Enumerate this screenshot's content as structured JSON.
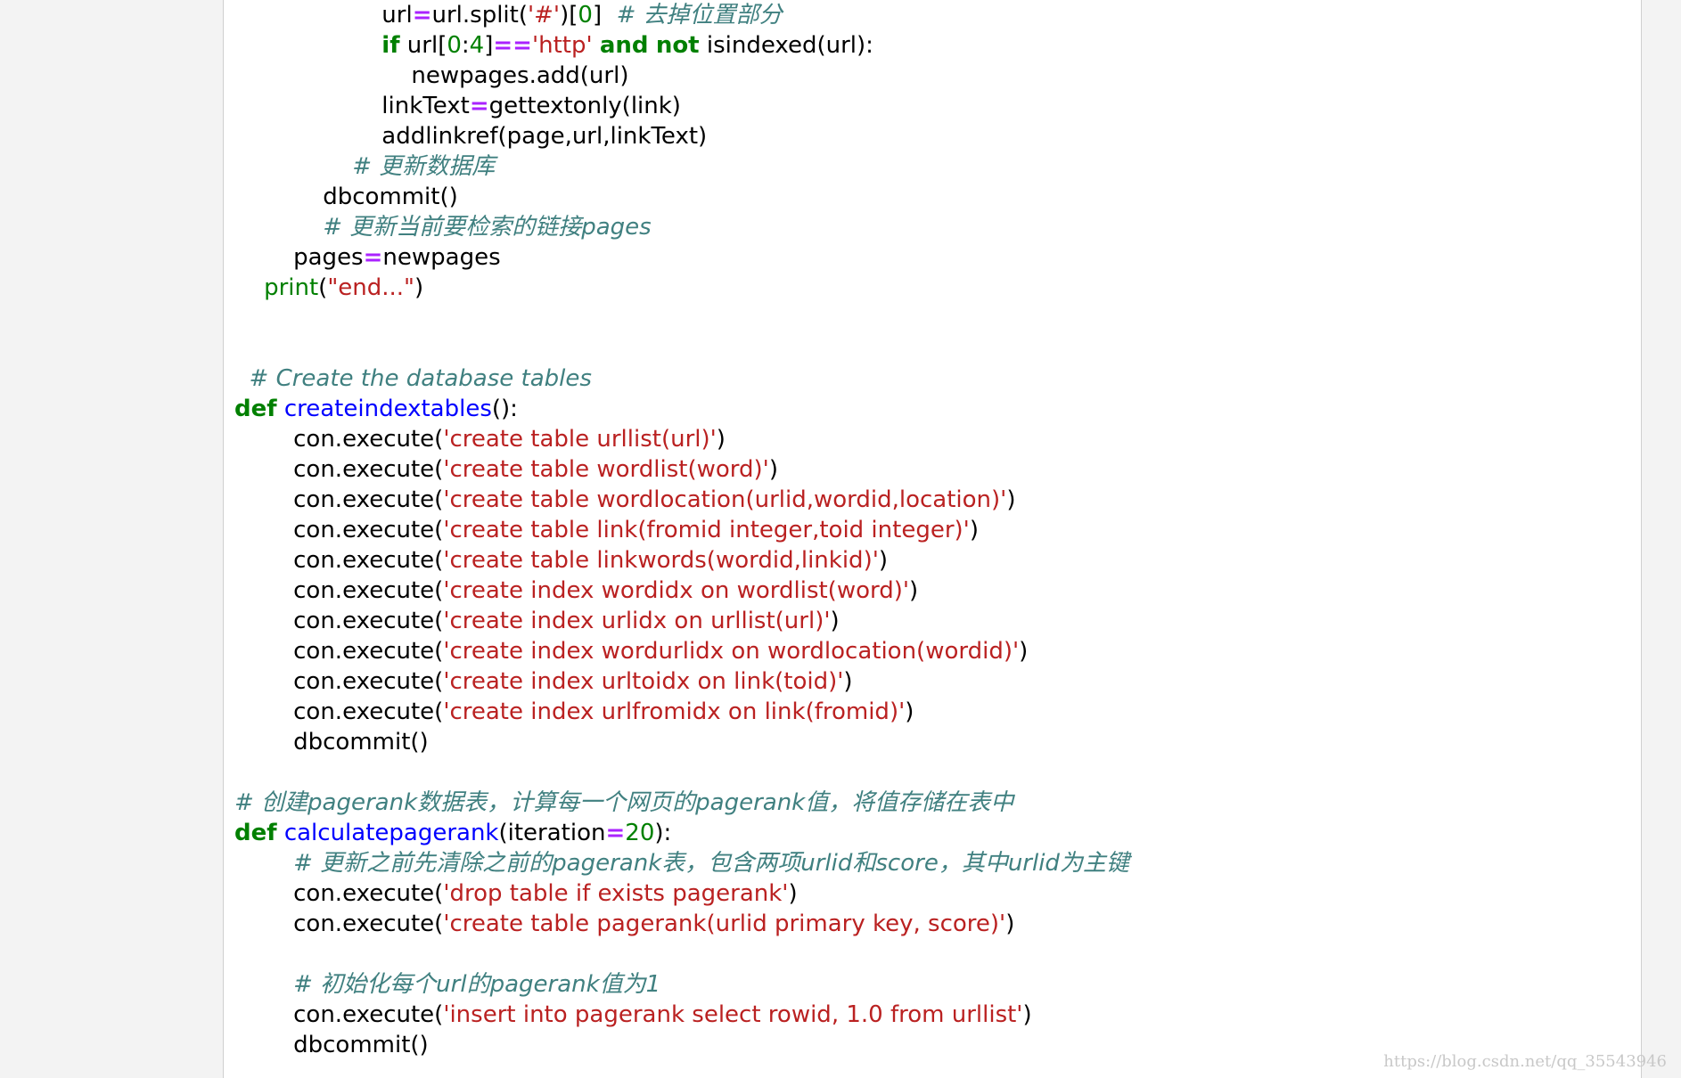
{
  "code": {
    "lines": [
      [
        {
          "t": "                    "
        },
        {
          "t": "url"
        },
        {
          "t": "=",
          "c": "op"
        },
        {
          "t": "url.split("
        },
        {
          "t": "'#'",
          "c": "st"
        },
        {
          "t": ")["
        },
        {
          "t": "0",
          "c": "nu"
        },
        {
          "t": "]  "
        },
        {
          "t": "# 去掉位置部分",
          "c": "cm"
        }
      ],
      [
        {
          "t": "                    "
        },
        {
          "t": "if",
          "c": "kw"
        },
        {
          "t": " url["
        },
        {
          "t": "0",
          "c": "nu"
        },
        {
          "t": ":"
        },
        {
          "t": "4",
          "c": "nu"
        },
        {
          "t": "]"
        },
        {
          "t": "==",
          "c": "op"
        },
        {
          "t": "'http'",
          "c": "st"
        },
        {
          "t": " "
        },
        {
          "t": "and",
          "c": "kw"
        },
        {
          "t": " "
        },
        {
          "t": "not",
          "c": "kw"
        },
        {
          "t": " isindexed(url):"
        }
      ],
      [
        {
          "t": "                        "
        },
        {
          "t": "newpages.add(url)"
        }
      ],
      [
        {
          "t": "                    "
        },
        {
          "t": "linkText"
        },
        {
          "t": "=",
          "c": "op"
        },
        {
          "t": "gettextonly(link)"
        }
      ],
      [
        {
          "t": "                    "
        },
        {
          "t": "addlinkref(page,url,linkText)"
        }
      ],
      [
        {
          "t": "                "
        },
        {
          "t": "# 更新数据库",
          "c": "cm"
        }
      ],
      [
        {
          "t": "            "
        },
        {
          "t": "dbcommit()"
        }
      ],
      [
        {
          "t": "            "
        },
        {
          "t": "# 更新当前要检索的链接pages",
          "c": "cm"
        }
      ],
      [
        {
          "t": "        "
        },
        {
          "t": "pages"
        },
        {
          "t": "=",
          "c": "op"
        },
        {
          "t": "newpages"
        }
      ],
      [
        {
          "t": "    "
        },
        {
          "t": "print",
          "c": "bi"
        },
        {
          "t": "("
        },
        {
          "t": "\"end...\"",
          "c": "st"
        },
        {
          "t": ")"
        }
      ],
      [],
      [],
      [
        {
          "t": "  "
        },
        {
          "t": "# Create the database tables",
          "c": "cm"
        }
      ],
      [
        {
          "t": "def",
          "c": "kw"
        },
        {
          "t": " "
        },
        {
          "t": "createindextables",
          "c": "fn"
        },
        {
          "t": "():"
        }
      ],
      [
        {
          "t": "        "
        },
        {
          "t": "con.execute("
        },
        {
          "t": "'create table urllist(url)'",
          "c": "st"
        },
        {
          "t": ")"
        }
      ],
      [
        {
          "t": "        "
        },
        {
          "t": "con.execute("
        },
        {
          "t": "'create table wordlist(word)'",
          "c": "st"
        },
        {
          "t": ")"
        }
      ],
      [
        {
          "t": "        "
        },
        {
          "t": "con.execute("
        },
        {
          "t": "'create table wordlocation(urlid,wordid,location)'",
          "c": "st"
        },
        {
          "t": ")"
        }
      ],
      [
        {
          "t": "        "
        },
        {
          "t": "con.execute("
        },
        {
          "t": "'create table link(fromid integer,toid integer)'",
          "c": "st"
        },
        {
          "t": ")"
        }
      ],
      [
        {
          "t": "        "
        },
        {
          "t": "con.execute("
        },
        {
          "t": "'create table linkwords(wordid,linkid)'",
          "c": "st"
        },
        {
          "t": ")"
        }
      ],
      [
        {
          "t": "        "
        },
        {
          "t": "con.execute("
        },
        {
          "t": "'create index wordidx on wordlist(word)'",
          "c": "st"
        },
        {
          "t": ")"
        }
      ],
      [
        {
          "t": "        "
        },
        {
          "t": "con.execute("
        },
        {
          "t": "'create index urlidx on urllist(url)'",
          "c": "st"
        },
        {
          "t": ")"
        }
      ],
      [
        {
          "t": "        "
        },
        {
          "t": "con.execute("
        },
        {
          "t": "'create index wordurlidx on wordlocation(wordid)'",
          "c": "st"
        },
        {
          "t": ")"
        }
      ],
      [
        {
          "t": "        "
        },
        {
          "t": "con.execute("
        },
        {
          "t": "'create index urltoidx on link(toid)'",
          "c": "st"
        },
        {
          "t": ")"
        }
      ],
      [
        {
          "t": "        "
        },
        {
          "t": "con.execute("
        },
        {
          "t": "'create index urlfromidx on link(fromid)'",
          "c": "st"
        },
        {
          "t": ")"
        }
      ],
      [
        {
          "t": "        "
        },
        {
          "t": "dbcommit()"
        }
      ],
      [],
      [
        {
          "t": "# 创建pagerank数据表，计算每一个网页的pagerank值，将值存储在表中",
          "c": "cm"
        }
      ],
      [
        {
          "t": "def",
          "c": "kw"
        },
        {
          "t": " "
        },
        {
          "t": "calculatepagerank",
          "c": "fn"
        },
        {
          "t": "(iteration"
        },
        {
          "t": "=",
          "c": "op"
        },
        {
          "t": "20",
          "c": "nu"
        },
        {
          "t": "):"
        }
      ],
      [
        {
          "t": "        "
        },
        {
          "t": "# 更新之前先清除之前的pagerank表，包含两项urlid和score，其中urlid为主键",
          "c": "cm"
        }
      ],
      [
        {
          "t": "        "
        },
        {
          "t": "con.execute("
        },
        {
          "t": "'drop table if exists pagerank'",
          "c": "st"
        },
        {
          "t": ")"
        }
      ],
      [
        {
          "t": "        "
        },
        {
          "t": "con.execute("
        },
        {
          "t": "'create table pagerank(urlid primary key, score)'",
          "c": "st"
        },
        {
          "t": ")"
        }
      ],
      [],
      [
        {
          "t": "        "
        },
        {
          "t": "# 初始化每个url的pagerank值为1",
          "c": "cm"
        }
      ],
      [
        {
          "t": "        "
        },
        {
          "t": "con.execute("
        },
        {
          "t": "'insert into pagerank select rowid, 1.0 from urllist'",
          "c": "st"
        },
        {
          "t": ")"
        }
      ],
      [
        {
          "t": "        "
        },
        {
          "t": "dbcommit()"
        }
      ]
    ]
  },
  "watermark": "https://blog.csdn.net/qq_35543946"
}
